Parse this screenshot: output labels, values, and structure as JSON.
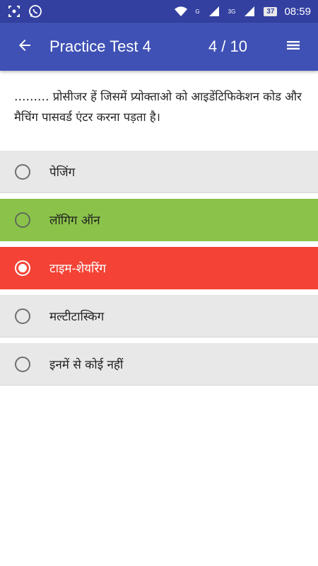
{
  "status_bar": {
    "left_icons": [
      "screenshot-icon",
      "whatsapp-icon"
    ],
    "right_icons": [
      "wifi-icon",
      "signal-icon",
      "signal-icon"
    ],
    "network_label_1": "G",
    "network_label_2": "3G",
    "battery": "37",
    "time": "08:59"
  },
  "app_bar": {
    "title": "Practice Test 4",
    "current_question": "4",
    "total_questions": "/ 10",
    "back_icon": "arrow-back-icon",
    "menu_icon": "menu-icon"
  },
  "question": {
    "text": "……… प्रोसीजर हें जिसमें प्र्योक्ताओ को आइडेंटिफिकेशन कोड और मैचिंग पासवर्ड एंटर करना पड़ता है।"
  },
  "options": [
    {
      "label": "पेजिंग",
      "state": "default",
      "selected": false
    },
    {
      "label": "लॉगिग ऑन",
      "state": "correct",
      "selected": false
    },
    {
      "label": "टाइम-शेयरिंग",
      "state": "wrong",
      "selected": true
    },
    {
      "label": "मल्टीटास्किग",
      "state": "default",
      "selected": false
    },
    {
      "label": "इनमें से कोई नहीं",
      "state": "default",
      "selected": false
    }
  ],
  "colors": {
    "status_bar": "#3340a0",
    "app_bar": "#3f51b5",
    "correct": "#8bc34a",
    "wrong": "#f44336",
    "default_option": "#e8e8e8"
  }
}
